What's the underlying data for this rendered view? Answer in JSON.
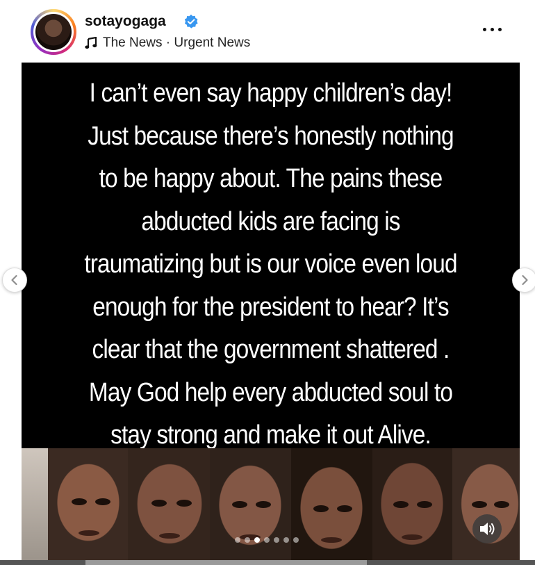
{
  "post": {
    "username": "sotayogaga",
    "audio_label": "The News · Urgent News",
    "text_lines": [
      "I can’t even say happy children’s day!",
      "Just because there’s honestly nothing",
      "to be happy about.  The pains these",
      "abducted kids are facing is",
      "traumatizing but is our voice even loud",
      "enough for the president to hear?  It’s",
      "clear that the government shattered .",
      "May God help every abducted soul to",
      "stay strong and make it out Alive."
    ]
  },
  "carousel": {
    "count": 7,
    "active_index": 2
  },
  "icons": {
    "verified": "verified-badge-icon",
    "music": "music-note-icon",
    "more": "more-options-icon",
    "sound": "speaker-icon",
    "prev": "chevron-left-icon",
    "next": "chevron-right-icon"
  },
  "colors": {
    "verified": "#3897f0",
    "media_bg": "#000000"
  }
}
